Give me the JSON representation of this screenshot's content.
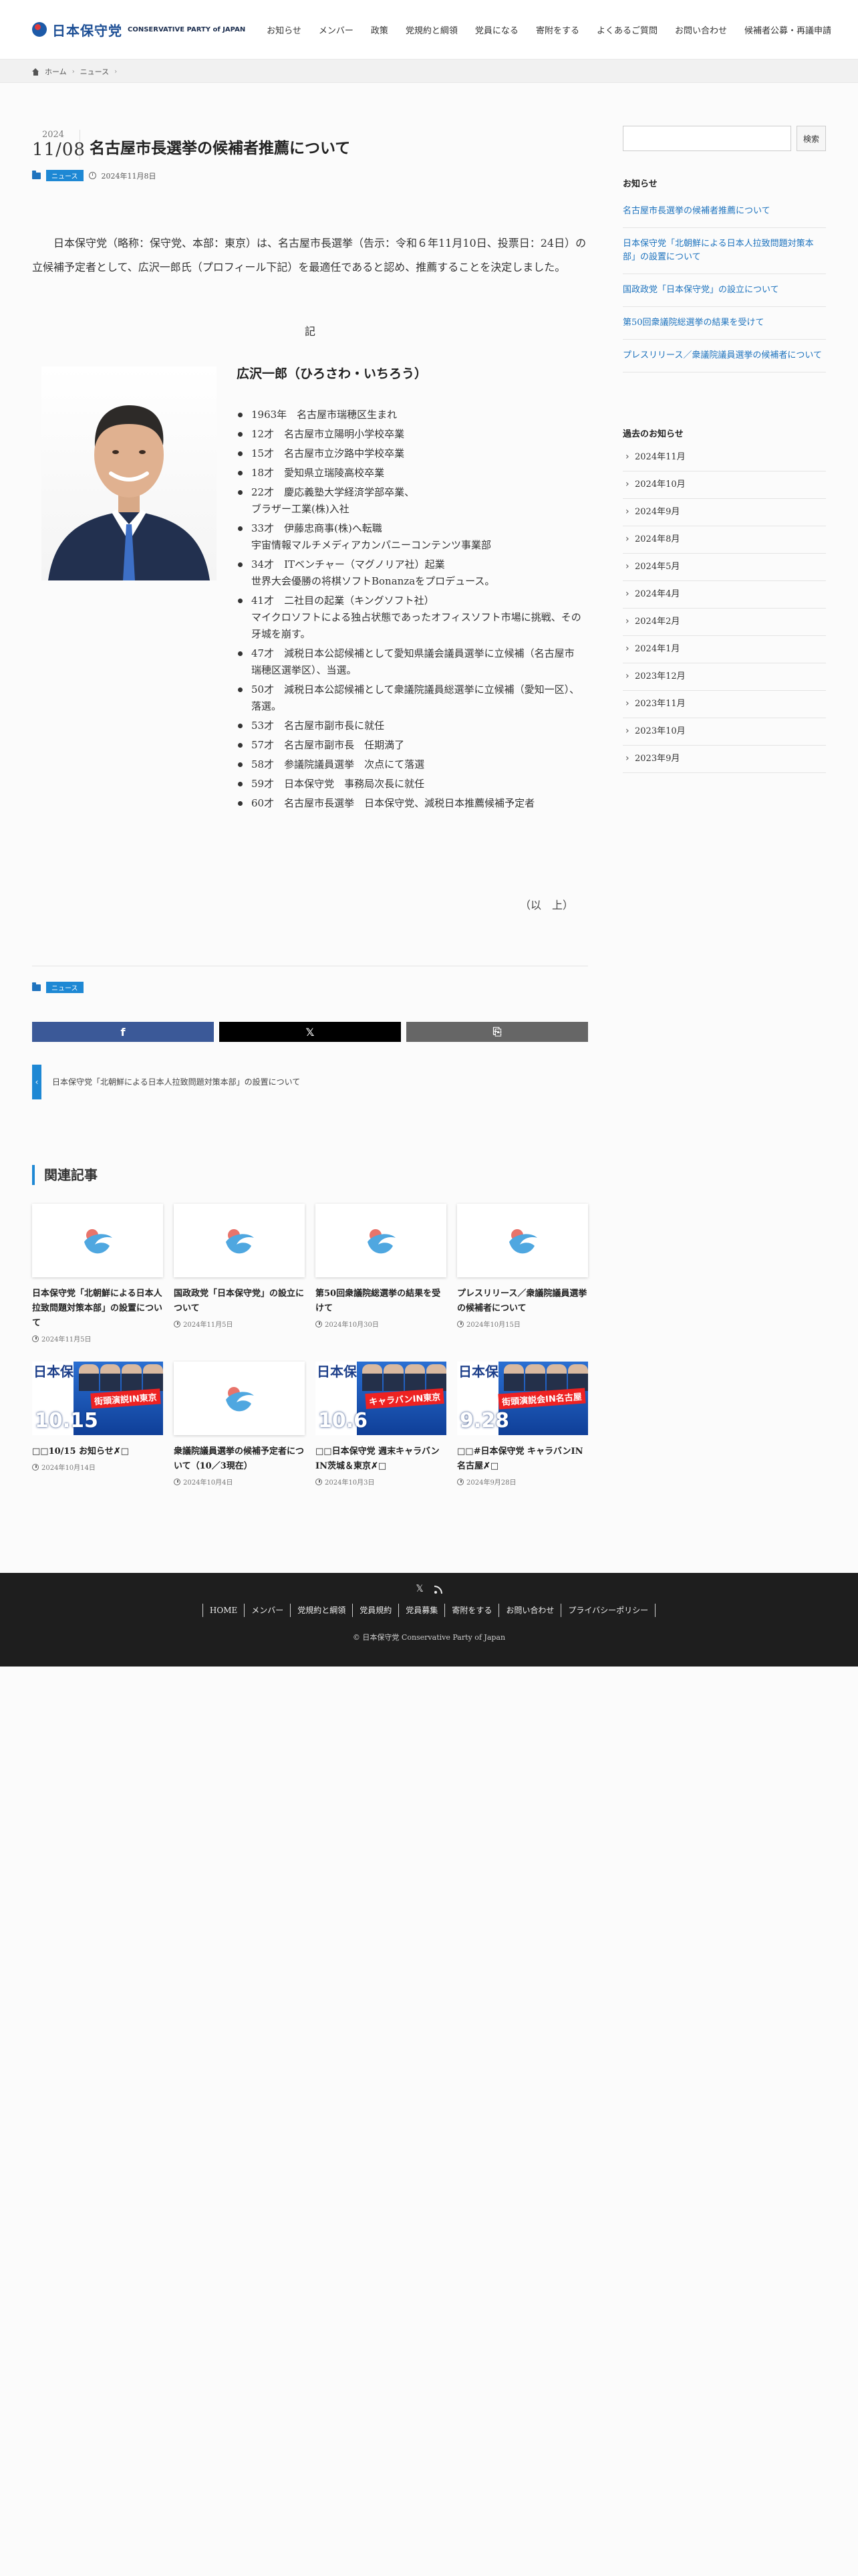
{
  "header": {
    "logo_jp": "日本保守党",
    "logo_en": "CONSERVATIVE PARTY of JAPAN",
    "nav": [
      "お知らせ",
      "メンバー",
      "政策",
      "党規約と綱領",
      "党員になる",
      "寄附をする",
      "よくあるご質問",
      "お問い合わせ",
      "候補者公募・再議申請"
    ]
  },
  "breadcrumb": {
    "home": "ホーム",
    "category": "ニュース"
  },
  "post": {
    "year": "2024",
    "month_day": "11/08",
    "title": "名古屋市長選挙の候補者推薦について",
    "category": "ニュース",
    "date": "2024年11月8日",
    "intro": "日本保守党（略称：保守党、本部：東京）は、名古屋市長選挙（告示：令和６年11月10日、投票日：24日）の立候補予定者として、広沢一郎氏（プロフィール下記）を最適任であると認め、推薦することを決定しました。",
    "ki": "記",
    "profile_name": "広沢一郎（ひろさわ・いちろう）",
    "career": [
      {
        "line1": "1963年　名古屋市瑞穂区生まれ",
        "line2": ""
      },
      {
        "line1": "12才　名古屋市立陽明小学校卒業",
        "line2": ""
      },
      {
        "line1": "15才　名古屋市立汐路中学校卒業",
        "line2": ""
      },
      {
        "line1": "18才　愛知県立瑞陵高校卒業",
        "line2": ""
      },
      {
        "line1": "22才　慶応義塾大学経済学部卒業、",
        "line2": "ブラザー工業(株)入社"
      },
      {
        "line1": "33才　伊藤忠商事(株)へ転職",
        "line2": "宇宙情報マルチメディアカンパニーコンテンツ事業部"
      },
      {
        "line1": "34才　ITベンチャー（マグノリア社）起業",
        "line2": "世界大会優勝の将棋ソフトBonanzaをプロデュース。"
      },
      {
        "line1": "41才　二社目の起業（キングソフト社）",
        "line2": "マイクロソフトによる独占状態であったオフィスソフト市場に挑戦、その牙城を崩す。"
      },
      {
        "line1": "47才　減税日本公認候補として愛知県議会議員選挙に立候補（名古屋市瑞穂区選挙区）、当選。",
        "line2": ""
      },
      {
        "line1": "50才　減税日本公認候補として衆議院議員総選挙に立候補（愛知一区）、落選。",
        "line2": ""
      },
      {
        "line1": "53才　名古屋市副市長に就任",
        "line2": ""
      },
      {
        "line1": "57才　名古屋市副市長　任期満了",
        "line2": ""
      },
      {
        "line1": "58才　参議院議員選挙　次点にて落選",
        "line2": ""
      },
      {
        "line1": "59才　日本保守党　事務局次長に就任",
        "line2": ""
      },
      {
        "line1": "60才　名古屋市長選挙　日本保守党、減税日本推薦候補予定者",
        "line2": ""
      }
    ],
    "closing": "（以　上）"
  },
  "share": {
    "facebook": "f",
    "x": "𝕏",
    "copy": "⎘"
  },
  "prev_post": "日本保守党「北朝鮮による日本人拉致問題対策本部」の設置について",
  "related": {
    "heading": "関連記事",
    "items": [
      {
        "title": "日本保守党「北朝鮮による日本人拉致問題対策本部」の設置について",
        "date": "2024年11月5日",
        "thumb": "logo"
      },
      {
        "title": "国政政党「日本保守党」の設立について",
        "date": "2024年11月5日",
        "thumb": "logo"
      },
      {
        "title": "第50回衆議院総選挙の結果を受けて",
        "date": "2024年10月30日",
        "thumb": "logo"
      },
      {
        "title": "プレスリリース／衆議院議員選挙の候補者について",
        "date": "2024年10月15日",
        "thumb": "logo"
      },
      {
        "title": "□□10/15 お知らせ✗□",
        "date": "2024年10月14日",
        "thumb": "banner",
        "banner_date": "10.15",
        "banner_tag": "街頭演説IN東京"
      },
      {
        "title": "衆議院議員選挙の候補予定者について（10／3現在）",
        "date": "2024年10月4日",
        "thumb": "logo"
      },
      {
        "title": "□□日本保守党 週末キャラバンIN茨城＆東京✗□",
        "date": "2024年10月3日",
        "thumb": "banner",
        "banner_date": "10.6",
        "banner_tag": "キャラバンIN東京"
      },
      {
        "title": "□□#日本保守党 キャラバンIN名古屋✗□",
        "date": "2024年9月28日",
        "thumb": "banner",
        "banner_date": "9.28",
        "banner_tag": "街頭演説会IN名古屋"
      }
    ]
  },
  "sidebar": {
    "search_placeholder": "",
    "search_button": "検索",
    "notice_heading": "お知らせ",
    "notices": [
      "名古屋市長選挙の候補者推薦について",
      "日本保守党「北朝鮮による日本人拉致問題対策本部」の設置について",
      "国政政党「日本保守党」の設立について",
      "第50回衆議院総選挙の結果を受けて",
      "プレスリリース／衆議院議員選挙の候補者について"
    ],
    "archive_heading": "過去のお知らせ",
    "archives": [
      "2024年11月",
      "2024年10月",
      "2024年9月",
      "2024年8月",
      "2024年5月",
      "2024年4月",
      "2024年2月",
      "2024年1月",
      "2023年12月",
      "2023年11月",
      "2023年10月",
      "2023年9月"
    ]
  },
  "footer": {
    "links": [
      "HOME",
      "メンバー",
      "党規約と綱領",
      "党員規約",
      "党員募集",
      "寄附をする",
      "お問い合わせ",
      "プライバシーポリシー"
    ],
    "copyright": "© 日本保守党 Conservative Party of Japan"
  },
  "colors": {
    "accent": "#1e88d4",
    "link": "#1e73be",
    "footer_bg": "#1e1e1e"
  }
}
